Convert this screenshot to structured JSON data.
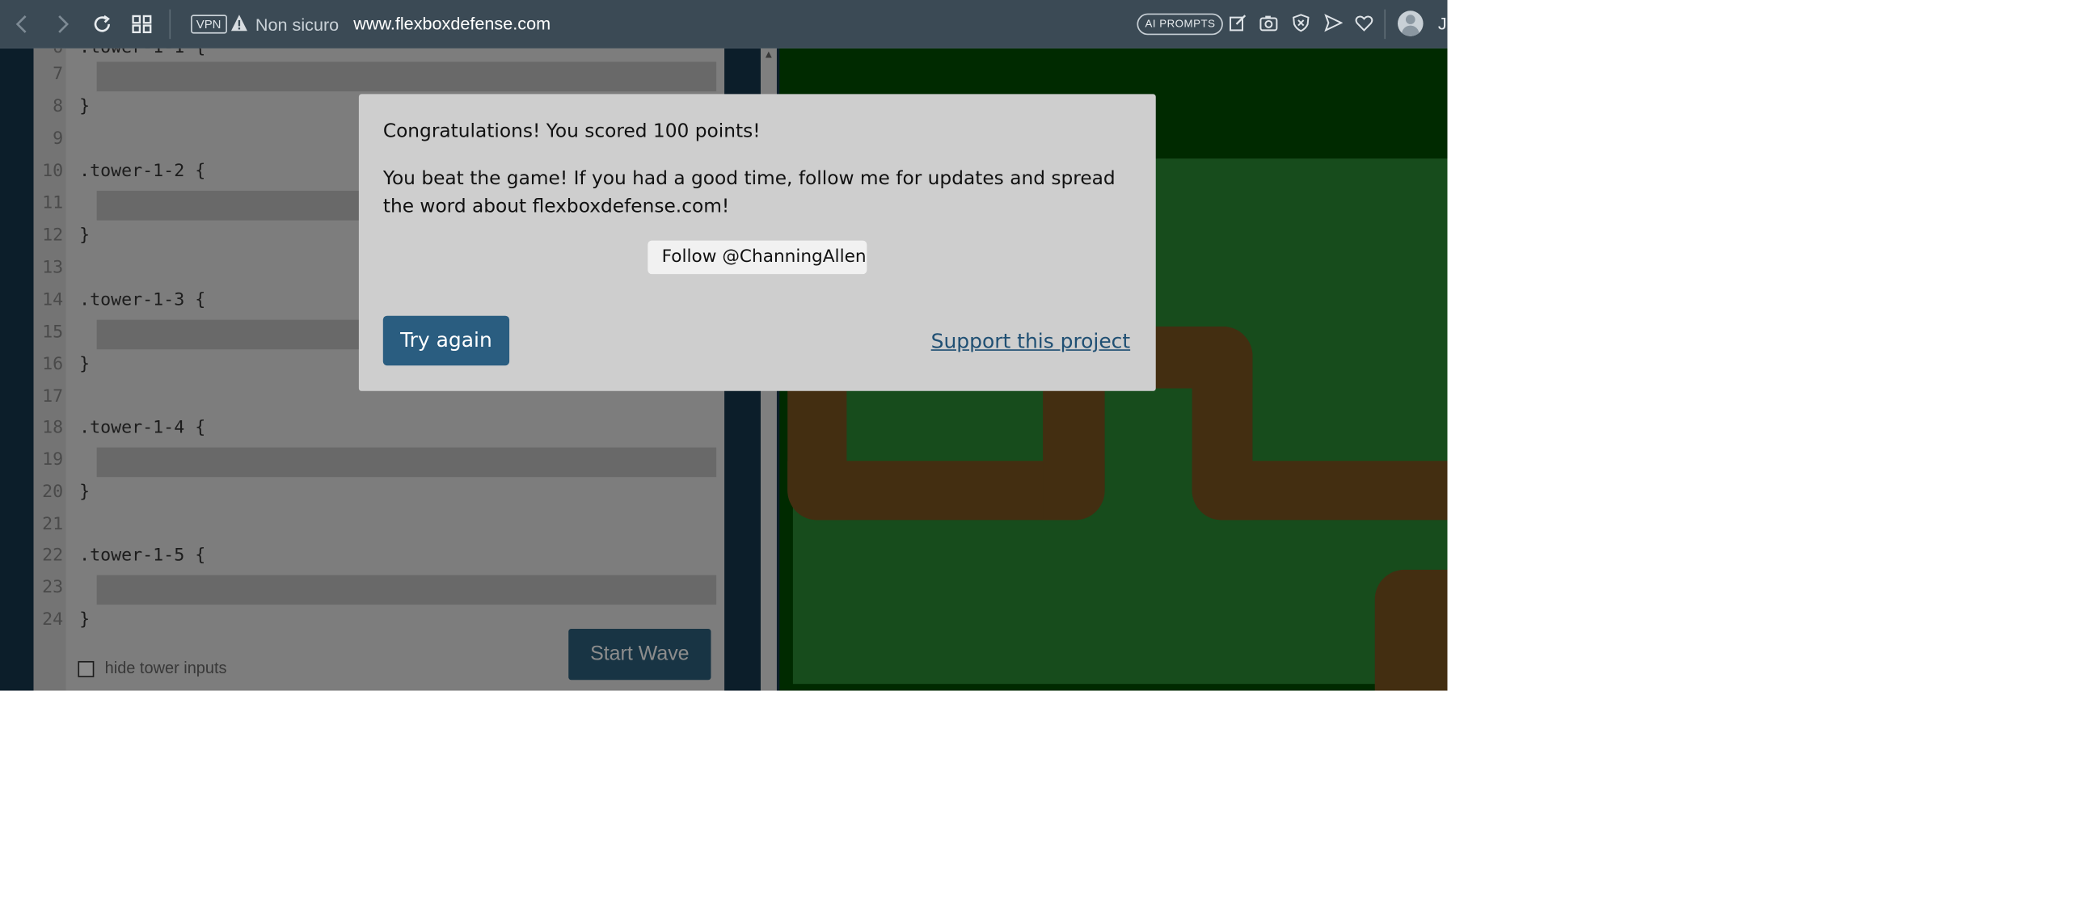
{
  "browser": {
    "vpn_label": "VPN",
    "security_text": "Non sicuro",
    "url": "www.flexboxdefense.com",
    "ai_prompts_label": "AI PROMPTS",
    "truncated_text": "J"
  },
  "editor": {
    "lines": [
      {
        "num": "7",
        "code": ""
      },
      {
        "num": "8",
        "code": "}"
      },
      {
        "num": "9",
        "code": ""
      },
      {
        "num": "10",
        "code": ".tower-1-2 {"
      },
      {
        "num": "11",
        "code": ""
      },
      {
        "num": "12",
        "code": "}"
      },
      {
        "num": "13",
        "code": ""
      },
      {
        "num": "14",
        "code": ".tower-1-3 {"
      },
      {
        "num": "15",
        "code": ""
      },
      {
        "num": "16",
        "code": "}"
      },
      {
        "num": "17",
        "code": ""
      },
      {
        "num": "18",
        "code": ".tower-1-4 {"
      },
      {
        "num": "19",
        "code": ""
      },
      {
        "num": "20",
        "code": "}"
      },
      {
        "num": "21",
        "code": ""
      },
      {
        "num": "22",
        "code": ".tower-1-5 {"
      },
      {
        "num": "23",
        "code": ""
      },
      {
        "num": "24",
        "code": "}"
      }
    ],
    "start_wave_label": "Start Wave",
    "hide_inputs_label": "hide tower inputs"
  },
  "modal": {
    "score_text": "Congratulations! You scored 100 points!",
    "message_text": "You beat the game! If you had a good time, follow me for updates and spread the word about flexboxdefense.com!",
    "follow_label": "Follow @ChanningAllen",
    "try_again_label": "Try again",
    "support_label": "Support this project"
  },
  "colors": {
    "accent": "#2a5d80",
    "board_dark": "#004d00",
    "board_field": "#2b8a33",
    "path": "#7a5520"
  }
}
